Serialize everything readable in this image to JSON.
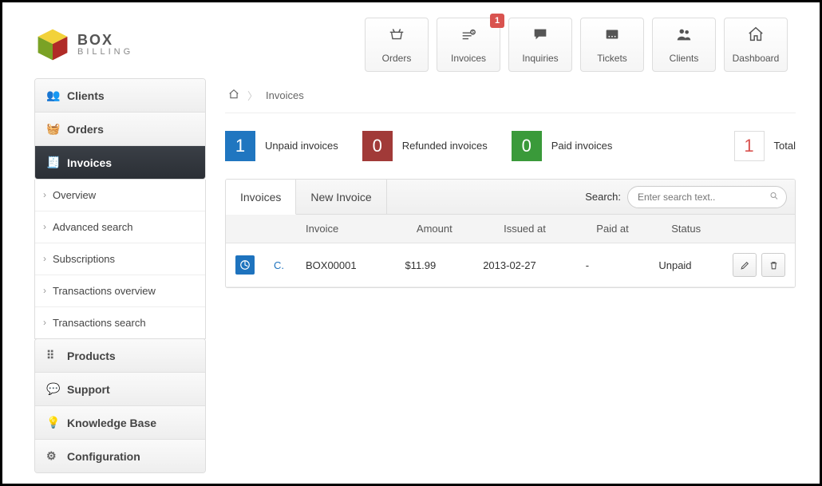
{
  "brand": {
    "top": "BOX",
    "bottom": "BILLING"
  },
  "topnav": {
    "orders": "Orders",
    "invoices": "Invoices",
    "invoices_badge": "1",
    "inquiries": "Inquiries",
    "tickets": "Tickets",
    "clients": "Clients",
    "dashboard": "Dashboard"
  },
  "sidebar": {
    "clients": "Clients",
    "orders": "Orders",
    "invoices": "Invoices",
    "submenu": {
      "overview": "Overview",
      "advanced_search": "Advanced search",
      "subscriptions": "Subscriptions",
      "transactions_overview": "Transactions overview",
      "transactions_search": "Transactions search"
    },
    "products": "Products",
    "support": "Support",
    "knowledge_base": "Knowledge Base",
    "configuration": "Configuration"
  },
  "breadcrumb": {
    "page": "Invoices"
  },
  "stats": {
    "unpaid": {
      "value": "1",
      "label": "Unpaid invoices"
    },
    "refunded": {
      "value": "0",
      "label": "Refunded invoices"
    },
    "paid": {
      "value": "0",
      "label": "Paid invoices"
    },
    "total": {
      "value": "1",
      "label": "Total"
    }
  },
  "tabs": {
    "invoices": "Invoices",
    "new_invoice": "New Invoice"
  },
  "search": {
    "label": "Search:",
    "placeholder": "Enter search text.."
  },
  "table": {
    "headers": {
      "client": "",
      "client2": "",
      "invoice": "Invoice",
      "amount": "Amount",
      "issued_at": "Issued at",
      "paid_at": "Paid at",
      "status": "Status",
      "actions": ""
    },
    "rows": [
      {
        "client_link": "C.",
        "invoice": "BOX00001",
        "amount": "$11.99",
        "issued_at": "2013-02-27",
        "paid_at": "-",
        "status": "Unpaid"
      }
    ]
  }
}
